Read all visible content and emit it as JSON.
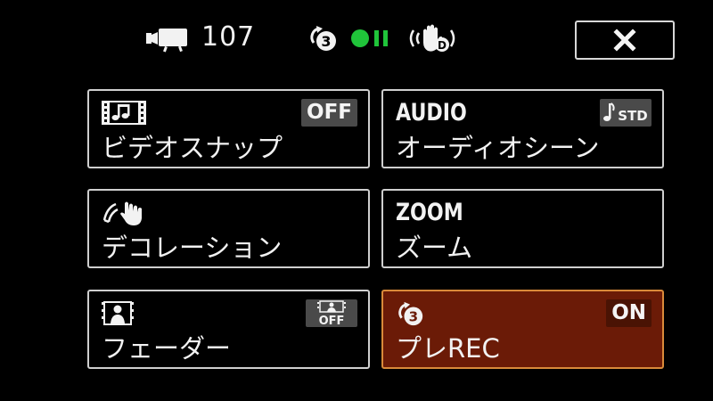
{
  "status_bar": {
    "recording_mode_icon": "movie-camera-icon",
    "remaining_shots": "107",
    "prerec_icon": "pre-rec-3-icon",
    "standby_icon": "record-standby-icon",
    "stabilizer_icon": "dynamic-stabilizer-icon",
    "close_icon": "close-icon",
    "standby_color": "#20c43a"
  },
  "menu": [
    {
      "id": "video-snapshot",
      "icon": "video-snapshot-icon",
      "label": "ビデオスナップ",
      "badge": "OFF"
    },
    {
      "id": "audio-scene",
      "code": "AUDIO",
      "label": "オーディオシーン",
      "badge_icon": "audio-std-icon",
      "badge_text": "STD"
    },
    {
      "id": "decoration",
      "icon": "decoration-hand-icon",
      "label": "デコレーション"
    },
    {
      "id": "zoom",
      "code": "ZOOM",
      "label": "ズーム"
    },
    {
      "id": "fader",
      "icon": "fader-icon",
      "label": "フェーダー",
      "badge_icon": "fader-off-icon",
      "badge_text": "OFF"
    },
    {
      "id": "pre-rec",
      "icon": "pre-rec-3-icon",
      "label": "プレREC",
      "badge": "ON",
      "selected": true
    }
  ],
  "colors": {
    "background": "#000000",
    "tile_border": "#cfcfcf",
    "active_tile_background": "#6b1b07",
    "active_tile_border": "#d98a3a",
    "badge_background": "#4a4a4a"
  }
}
